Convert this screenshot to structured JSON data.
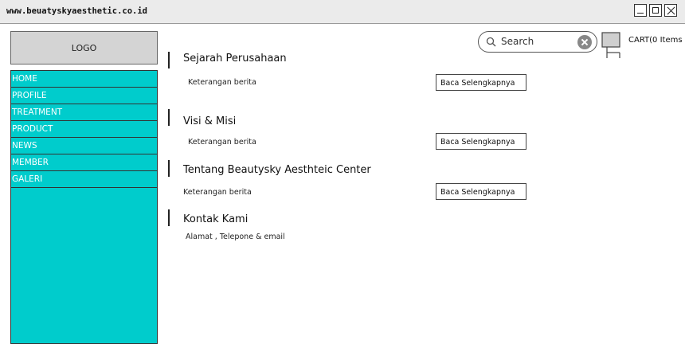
{
  "browser": {
    "url": "www.beuatyskyaesthetic.co.id"
  },
  "logo": {
    "label": "LOGO"
  },
  "nav": {
    "items": [
      {
        "label": "HOME"
      },
      {
        "label": "PROFILE"
      },
      {
        "label": "TREATMENT"
      },
      {
        "label": "PRODUCT"
      },
      {
        "label": "NEWS"
      },
      {
        "label": "MEMBER"
      },
      {
        "label": "GALERI"
      }
    ]
  },
  "header": {
    "search_placeholder": "Search",
    "cart_label": "CART(0 Items"
  },
  "sections": [
    {
      "title": "Sejarah Perusahaan",
      "desc": "Keterangan berita",
      "button": "Baca Selengkapnya"
    },
    {
      "title": "Visi & Misi",
      "desc": "Keterangan berita",
      "button": "Baca Selengkapnya"
    },
    {
      "title": "Tentang Beautysky Aesthteic Center",
      "desc": "Keterangan berita",
      "button": "Baca Selengkapnya"
    },
    {
      "title": "Kontak Kami",
      "desc": "Alamat , Telepone & email"
    }
  ]
}
